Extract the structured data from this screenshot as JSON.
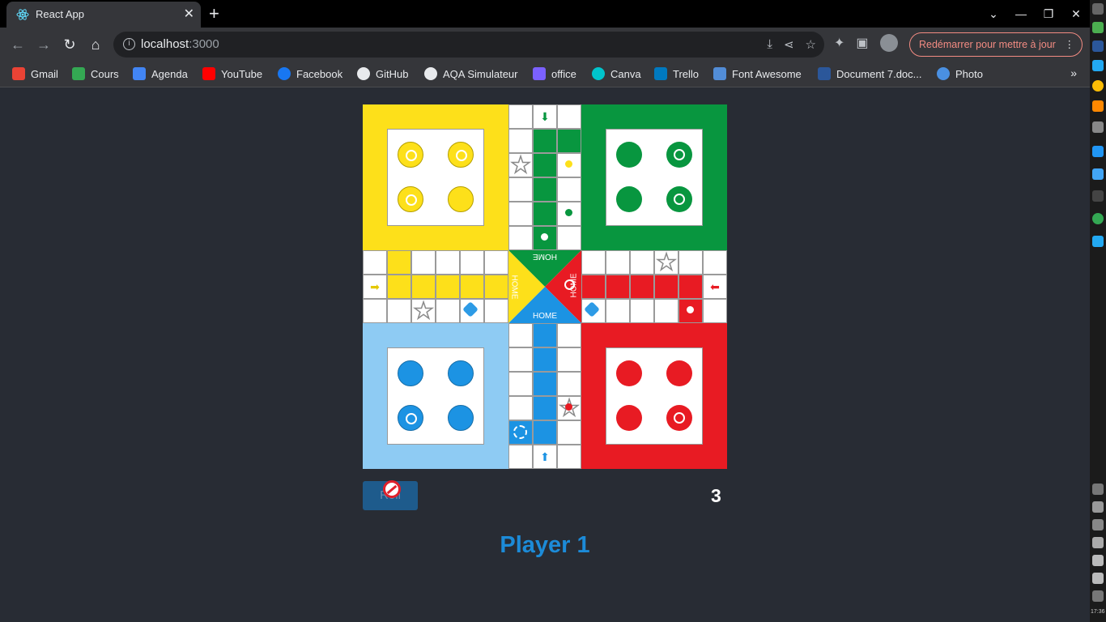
{
  "browser": {
    "tab_title": "React App",
    "url_host": "localhost",
    "url_port": ":3000",
    "update_label": "Redémarrer pour mettre à jour",
    "bookmarks": [
      {
        "label": "Gmail",
        "color": "#ea4335"
      },
      {
        "label": "Cours",
        "color": "#34a853"
      },
      {
        "label": "Agenda",
        "color": "#4285f4"
      },
      {
        "label": "YouTube",
        "color": "#ff0000"
      },
      {
        "label": "Facebook",
        "color": "#1877f2"
      },
      {
        "label": "GitHub",
        "color": "#e8eaed"
      },
      {
        "label": "AQA Simulateur",
        "color": "#e8eaed"
      },
      {
        "label": "office",
        "color": "#7b61ff"
      },
      {
        "label": "Canva",
        "color": "#00c4cc"
      },
      {
        "label": "Trello",
        "color": "#0079bf"
      },
      {
        "label": "Font Awesome",
        "color": "#528dd7"
      },
      {
        "label": "Document 7.doc...",
        "color": "#2b579a"
      },
      {
        "label": "Photo",
        "color": "#4a90e2"
      }
    ],
    "more_label": "»"
  },
  "game": {
    "roll_label": "Roll",
    "dice_value": "3",
    "current_player": "Player 1",
    "home_label": "HOME",
    "colors": {
      "yellow": "#fde01a",
      "green": "#08963f",
      "red": "#e81b23",
      "blue": "#1c93e3",
      "blue_light": "#8ecbf3"
    }
  },
  "taskbar": {
    "clock": "17:36"
  }
}
